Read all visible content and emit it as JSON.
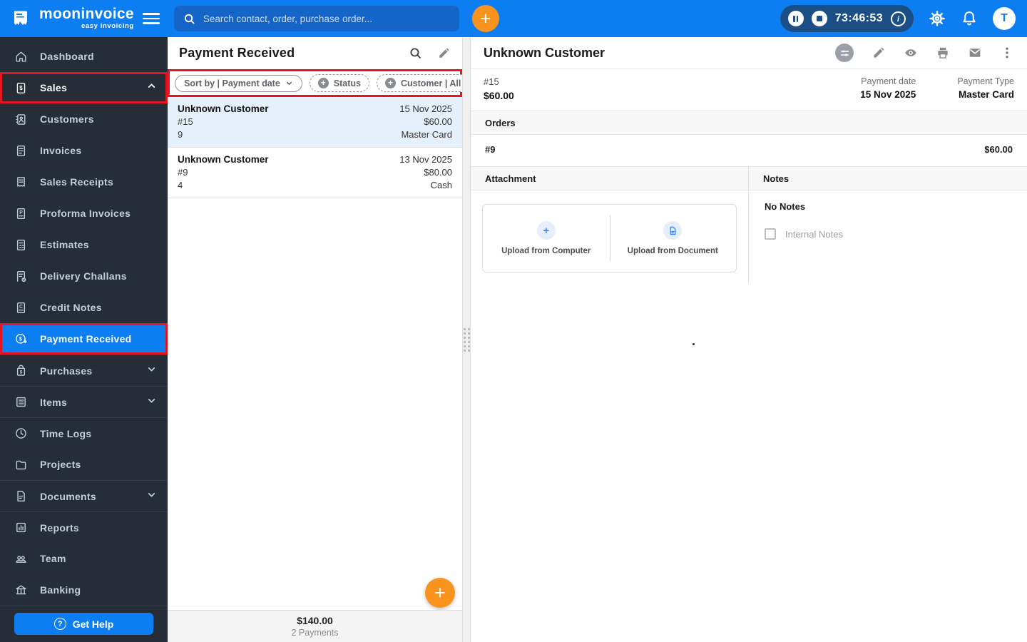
{
  "header": {
    "brand_name": "mooninvoice",
    "brand_tagline": "easy invoicing",
    "search_placeholder": "Search contact, order, purchase order...",
    "timer_value": "73:46:53",
    "avatar_initial": "T"
  },
  "sidebar": {
    "items": [
      {
        "label": "Dashboard"
      },
      {
        "label": "Sales"
      },
      {
        "label": "Customers"
      },
      {
        "label": "Invoices"
      },
      {
        "label": "Sales Receipts"
      },
      {
        "label": "Proforma Invoices"
      },
      {
        "label": "Estimates"
      },
      {
        "label": "Delivery Challans"
      },
      {
        "label": "Credit Notes"
      },
      {
        "label": "Payment Received"
      },
      {
        "label": "Purchases"
      },
      {
        "label": "Items"
      },
      {
        "label": "Time Logs"
      },
      {
        "label": "Projects"
      },
      {
        "label": "Documents"
      },
      {
        "label": "Reports"
      },
      {
        "label": "Team"
      },
      {
        "label": "Banking"
      }
    ],
    "get_help_label": "Get Help"
  },
  "list_panel": {
    "title": "Payment Received",
    "filters": {
      "sort_label": "Sort by | Payment date",
      "status_label": "Status",
      "customer_label": "Customer | All"
    },
    "payments": [
      {
        "customer": "Unknown Customer",
        "number": "#15",
        "ref": "9",
        "date": "15 Nov 2025",
        "amount": "$60.00",
        "method": "Master Card"
      },
      {
        "customer": "Unknown Customer",
        "number": "#9",
        "ref": "4",
        "date": "13 Nov 2025",
        "amount": "$80.00",
        "method": "Cash"
      }
    ],
    "footer_total": "$140.00",
    "footer_count": "2 Payments"
  },
  "detail_panel": {
    "title": "Unknown Customer",
    "payment_number": "#15",
    "payment_amount": "$60.00",
    "payment_date_label": "Payment date",
    "payment_date_value": "15 Nov 2025",
    "payment_type_label": "Payment Type",
    "payment_type_value": "Master Card",
    "orders_heading": "Orders",
    "order_number": "#9",
    "order_amount": "$60.00",
    "attachment_heading": "Attachment",
    "upload_computer_label": "Upload from Computer",
    "upload_document_label": "Upload from Document",
    "notes_heading": "Notes",
    "no_notes_text": "No Notes",
    "internal_notes_label": "Internal Notes"
  },
  "colors": {
    "header_blue": "#0d7ef2",
    "sidebar_dark": "#262d37",
    "active_blue": "#0d7ef2",
    "annotation_red": "#e51420",
    "fab_orange": "#f8941d",
    "selected_row_blue": "#e4f1fc",
    "timer_pill_navy": "#1a4e84"
  }
}
